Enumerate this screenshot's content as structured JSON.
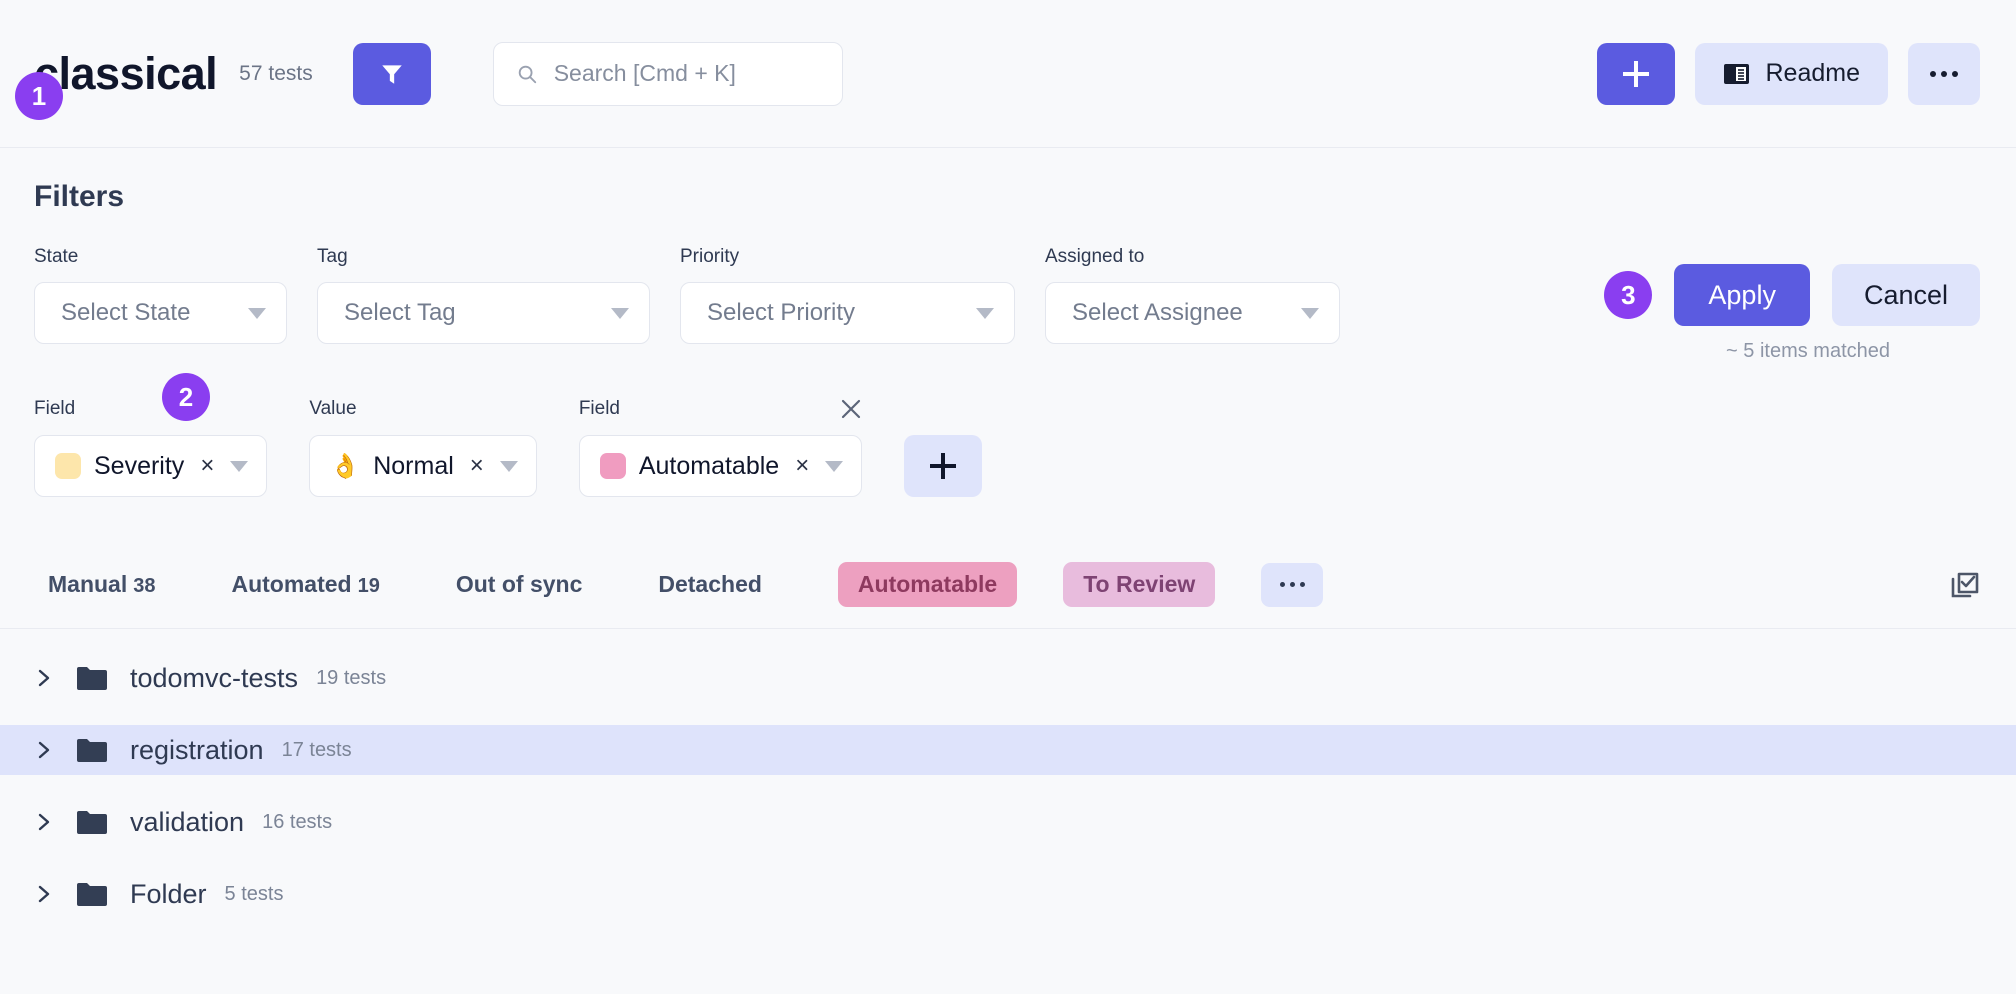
{
  "header": {
    "brand": "classical",
    "test_count": "57 tests",
    "filter_icon": "funnel-icon",
    "badge_1": "1",
    "search": {
      "placeholder": "Search [Cmd + K]",
      "value": "",
      "icon": "search-icon"
    },
    "add_button_icon": "plus-icon",
    "readme_label": "Readme",
    "readme_icon": "book-icon",
    "more_icon": "ellipsis-icon"
  },
  "filters": {
    "title": "Filters",
    "badge_2": "2",
    "badge_3": "3",
    "apply_label": "Apply",
    "cancel_label": "Cancel",
    "matched_text": "~ 5 items matched",
    "selects": [
      {
        "label": "State",
        "placeholder": "Select State",
        "value": ""
      },
      {
        "label": "Tag",
        "placeholder": "Select Tag",
        "value": ""
      },
      {
        "label": "Priority",
        "placeholder": "Select Priority",
        "value": ""
      },
      {
        "label": "Assigned to",
        "placeholder": "Select Assignee",
        "value": ""
      }
    ],
    "conditions": [
      {
        "label": "Field",
        "value": "Severity",
        "swatch": "#fde6ab",
        "emoji": "",
        "clear": "×"
      },
      {
        "label": "Value",
        "value": "Normal",
        "swatch": "",
        "emoji": "👌",
        "clear": "×"
      },
      {
        "label": "Field",
        "value": "Automatable",
        "swatch": "#f09cc0",
        "emoji": "",
        "clear": "×",
        "remove_icon": "close-icon"
      }
    ],
    "add_condition_icon": "plus-icon"
  },
  "tabs": {
    "items": [
      {
        "label": "Manual",
        "count": "38",
        "type": "text"
      },
      {
        "label": "Automated",
        "count": "19",
        "type": "text"
      },
      {
        "label": "Out of sync",
        "count": "",
        "type": "text"
      },
      {
        "label": "Detached",
        "count": "",
        "type": "text"
      },
      {
        "label": "Automatable",
        "count": "",
        "type": "pill-automatable"
      },
      {
        "label": "To Review",
        "count": "",
        "type": "pill-toreview"
      }
    ],
    "more_icon": "ellipsis-icon",
    "select_all_icon": "checkbox-select-icon"
  },
  "tree": {
    "rows": [
      {
        "name": "todomvc-tests",
        "count": "19 tests",
        "selected": false
      },
      {
        "name": "registration",
        "count": "17 tests",
        "selected": true
      },
      {
        "name": "validation",
        "count": "16 tests",
        "selected": false
      },
      {
        "name": "Folder",
        "count": "5 tests",
        "selected": false
      }
    ],
    "chevron_icon": "chevron-right-icon",
    "folder_icon": "folder-icon"
  },
  "colors": {
    "accent": "#5b5be0",
    "badge": "#8a3ef0",
    "soft_accent": "#dfe4fb",
    "selected_row": "#dee3fb",
    "pill_automatable_bg": "#eda0c0",
    "pill_automatable_fg": "#8e3a5f",
    "pill_toreview_bg": "#e8bcdd",
    "pill_toreview_fg": "#7e4373",
    "page_bg": "#f8f9fb"
  }
}
